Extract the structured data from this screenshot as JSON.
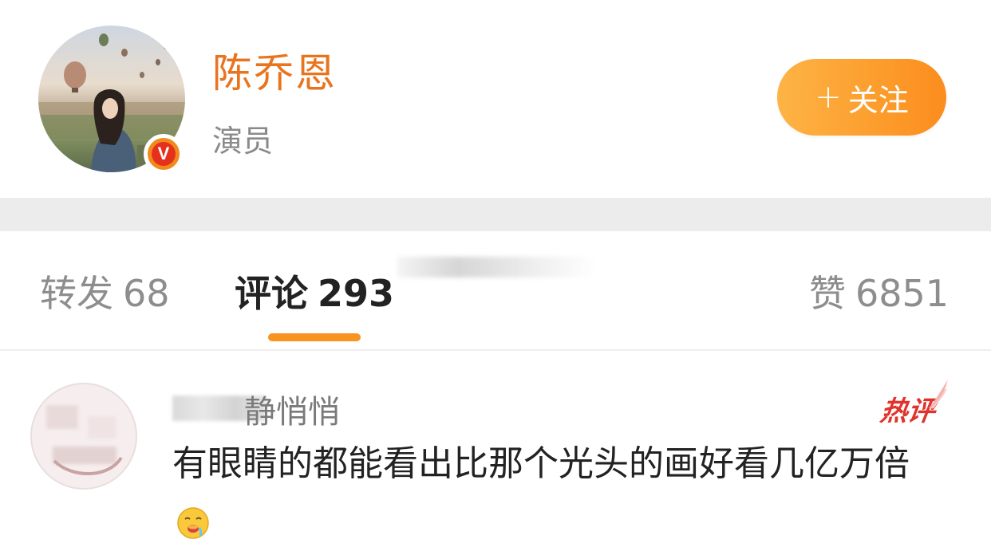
{
  "profile": {
    "name": "陈乔恩",
    "title": "演员",
    "verified_badge": "V",
    "follow_plus": "+",
    "follow_label": "关注",
    "avatar_icon": "hot-air-balloon-photo-avatar"
  },
  "tabs": [
    {
      "label": "转发",
      "count": "68",
      "active": false
    },
    {
      "label": "评论",
      "count": "293",
      "active": true
    },
    {
      "label": "赞",
      "count": "6851",
      "active": false
    }
  ],
  "comment": {
    "author_visible": "静悄悄",
    "hot_label": "热评",
    "text": "有眼睛的都能看出比那个光头的画好看几亿万倍",
    "emoji_icon": "drooling-face-emoji"
  },
  "colors": {
    "accent_orange": "#e8741e",
    "follow_button": "#fb8d1d",
    "tab_indicator": "#f7931e",
    "hot_red": "#e0332c"
  }
}
